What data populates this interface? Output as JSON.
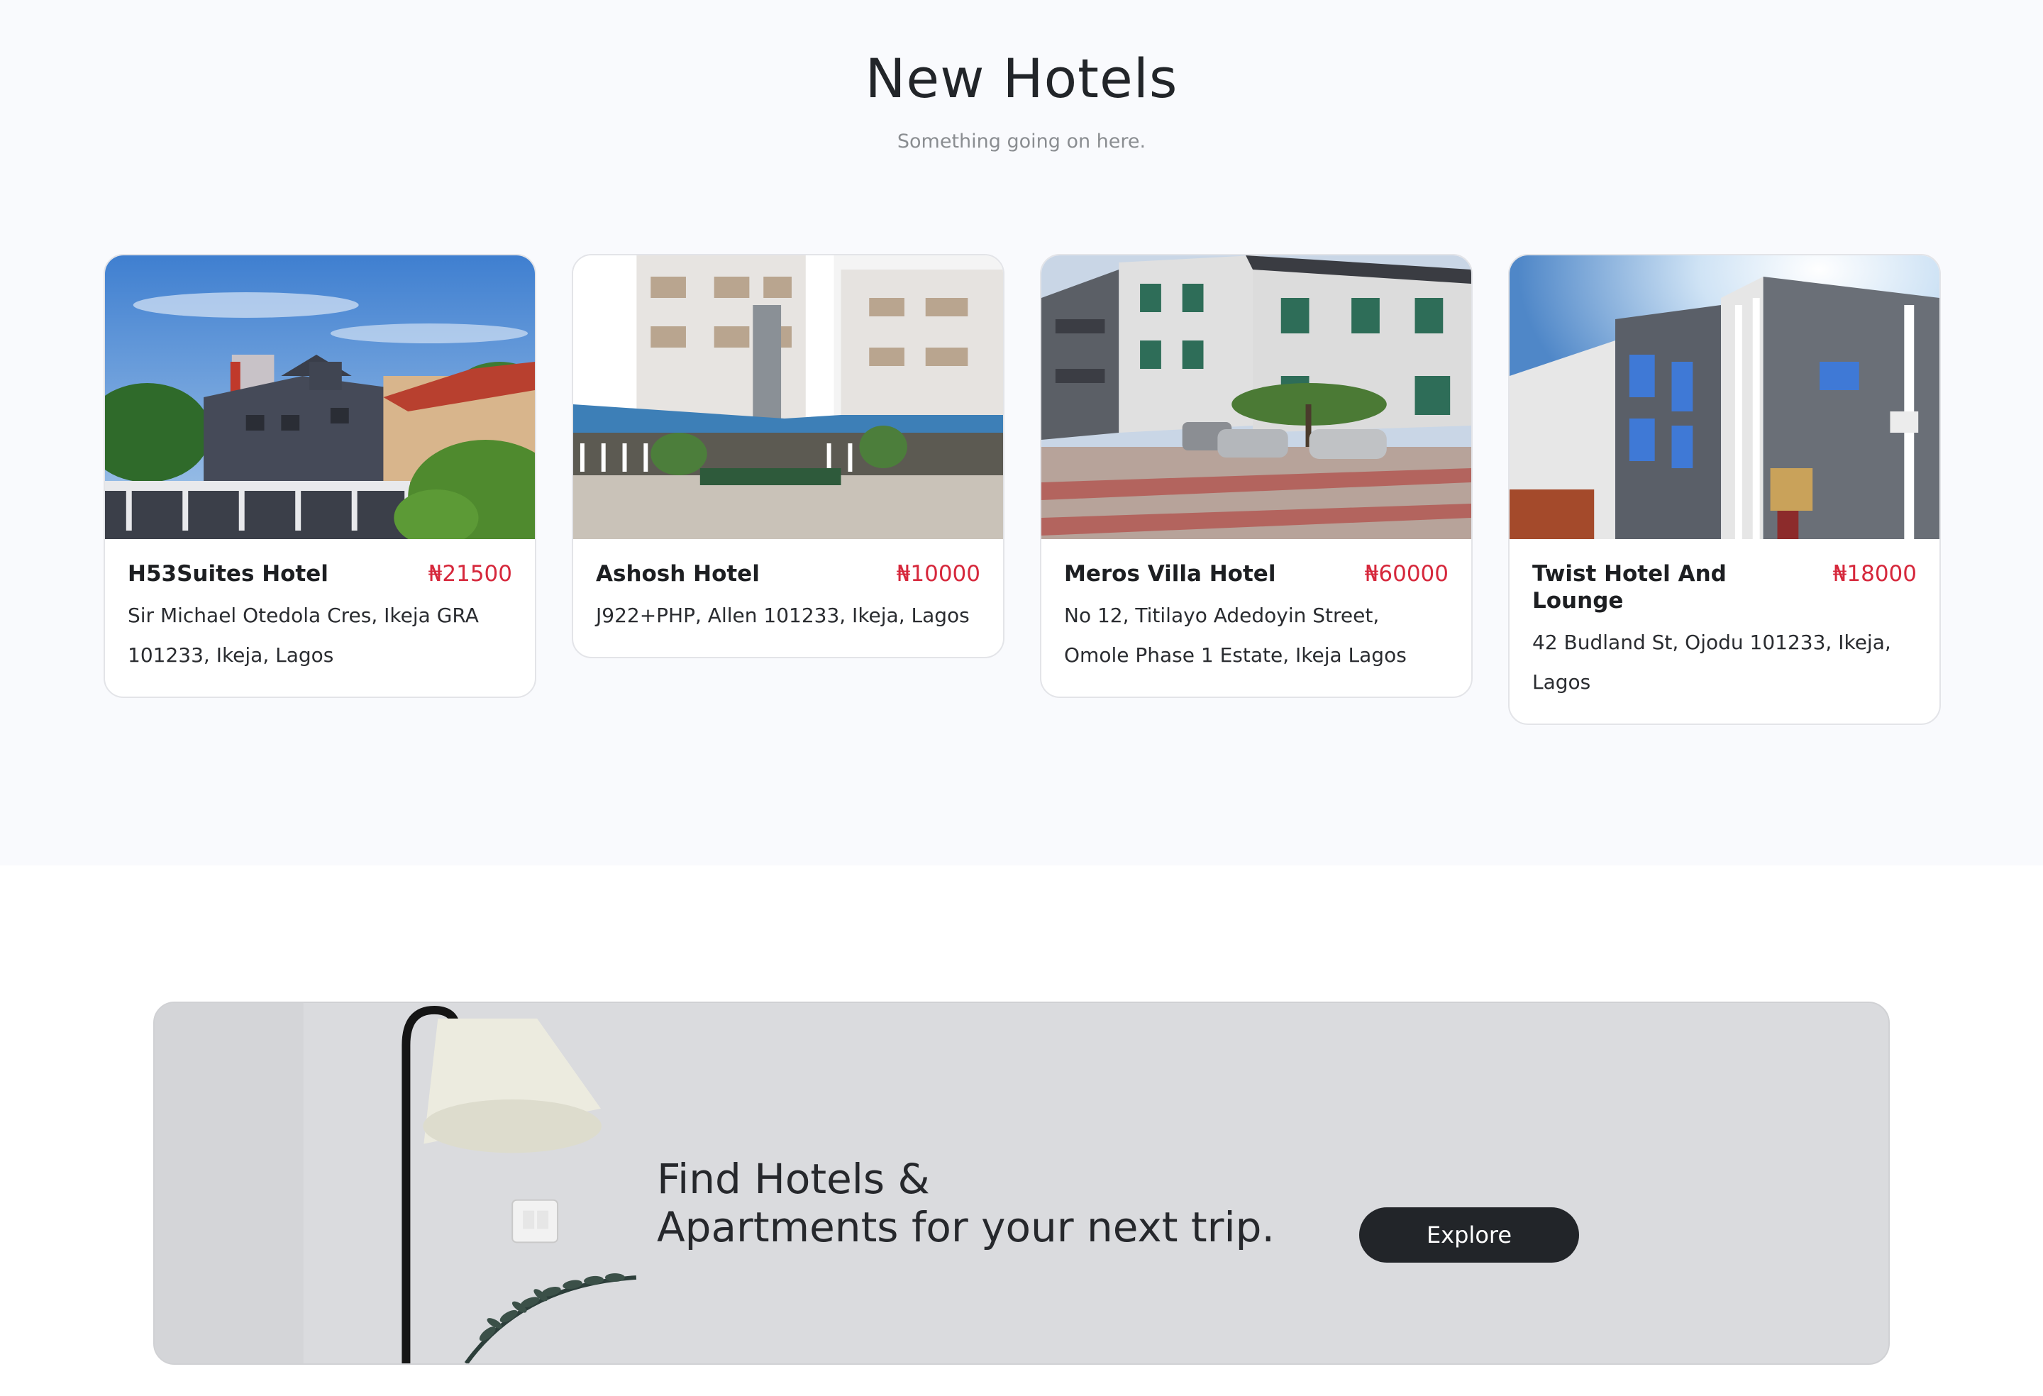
{
  "hotels_section": {
    "title": "New Hotels",
    "subtitle": "Something going on here."
  },
  "hotels": [
    {
      "name": "H53Suites Hotel",
      "price": "₦21500",
      "address": "Sir Michael Otedola Cres, Ikeja GRA 101233, Ikeja, Lagos"
    },
    {
      "name": "Ashosh Hotel",
      "price": "₦10000",
      "address": "J922+PHP, Allen 101233, Ikeja, Lagos"
    },
    {
      "name": "Meros Villa Hotel",
      "price": "₦60000",
      "address": "No 12, Titilayo Adedoyin Street, Omole Phase 1 Estate, Ikeja Lagos"
    },
    {
      "name": "Twist Hotel And Lounge",
      "price": "₦18000",
      "address": "42 Budland St, Ojodu 101233, Ikeja, Lagos"
    }
  ],
  "promo": {
    "line1": "Find Hotels &",
    "line2": "Apartments for your next trip.",
    "button_label": "Explore"
  },
  "colors": {
    "price": "#d6283c",
    "button_bg": "#222529",
    "section_bg": "#f9fafd"
  }
}
